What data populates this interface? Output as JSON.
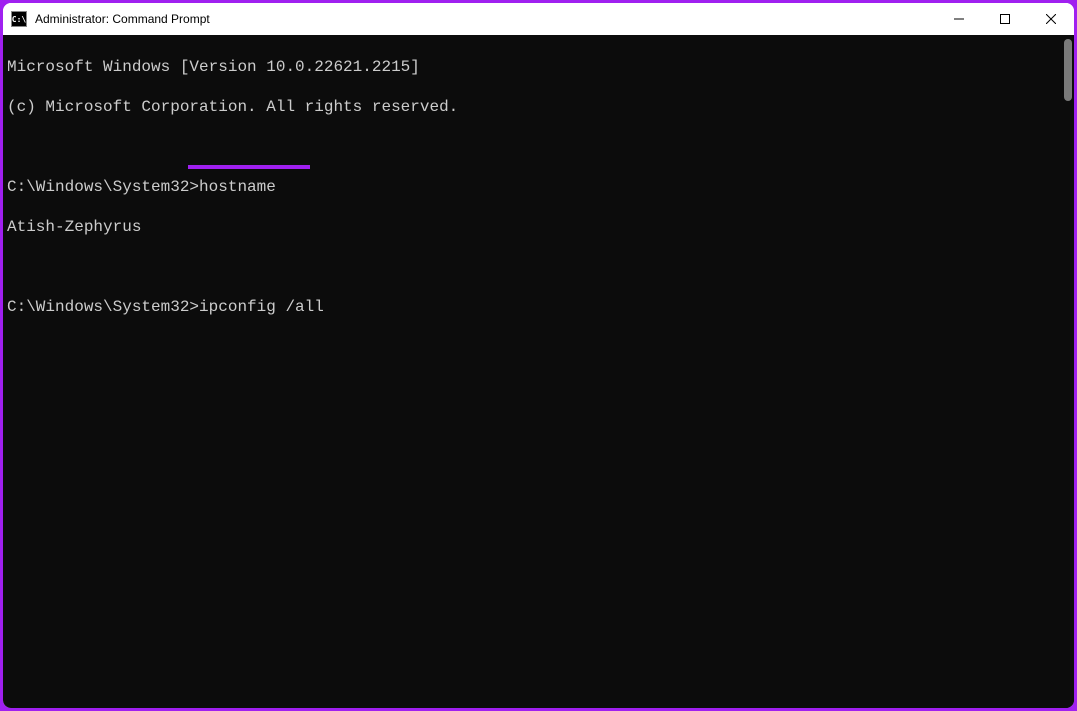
{
  "window": {
    "title": "Administrator: Command Prompt"
  },
  "terminal": {
    "lines": [
      "Microsoft Windows [Version 10.0.22621.2215]",
      "(c) Microsoft Corporation. All rights reserved.",
      "",
      "C:\\Windows\\System32>hostname",
      "Atish-Zephyrus",
      "",
      "C:\\Windows\\System32>ipconfig /all"
    ],
    "highlighted_command": "ipconfig /all"
  },
  "colors": {
    "accent": "#a020f0",
    "terminal_bg": "#0c0c0c",
    "terminal_fg": "#cccccc"
  }
}
